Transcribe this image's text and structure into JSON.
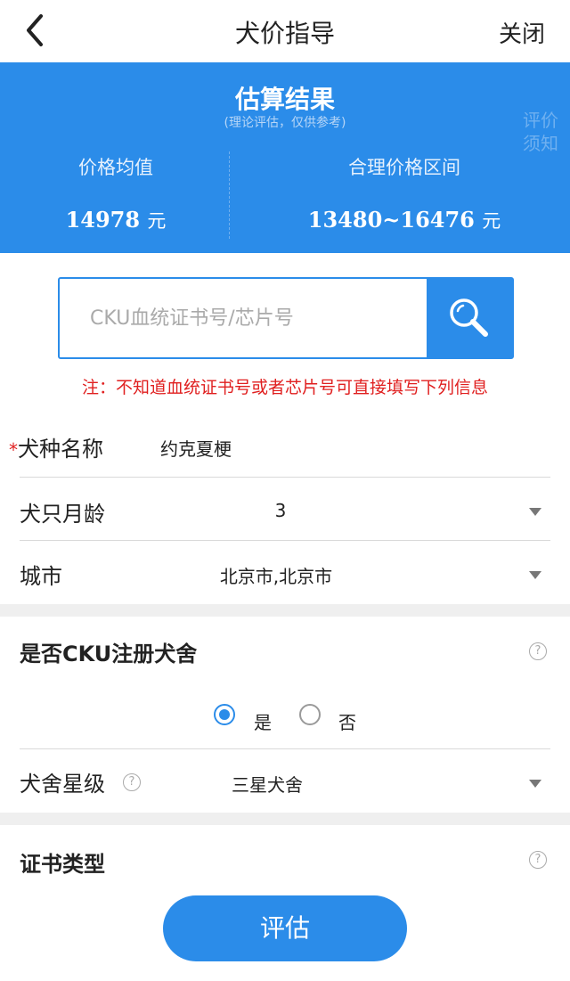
{
  "nav": {
    "title": "犬价指导",
    "close_label": "关闭"
  },
  "result": {
    "title": "估算结果",
    "subtitle": "(理论评估，仅供参考)",
    "notice_label": "评价须知",
    "avg_label": "价格均值",
    "avg_value": "14978",
    "avg_unit": "元",
    "range_label": "合理价格区间",
    "range_value": "13480~16476",
    "range_unit": "元"
  },
  "search": {
    "placeholder": "CKU血统证书号/芯片号"
  },
  "note": "注：不知道血统证书号或者芯片号可直接填写下列信息",
  "form": {
    "breed": {
      "required_mark": "*",
      "label": "犬种名称",
      "value": "约克夏梗"
    },
    "age": {
      "label": "犬只月龄",
      "value": "3"
    },
    "city": {
      "label": "城市",
      "value": "北京市,北京市"
    },
    "kennel": {
      "label": "是否CKU注册犬舍",
      "yes": "是",
      "no": "否",
      "selected": "是"
    },
    "kennel_level": {
      "label": "犬舍星级",
      "value": "三星犬舍"
    },
    "cert_type": {
      "label": "证书类型"
    }
  },
  "help_symbol": "?",
  "submit_label": "评估",
  "colors": {
    "primary": "#2b8ce9",
    "warning": "#e02020"
  }
}
